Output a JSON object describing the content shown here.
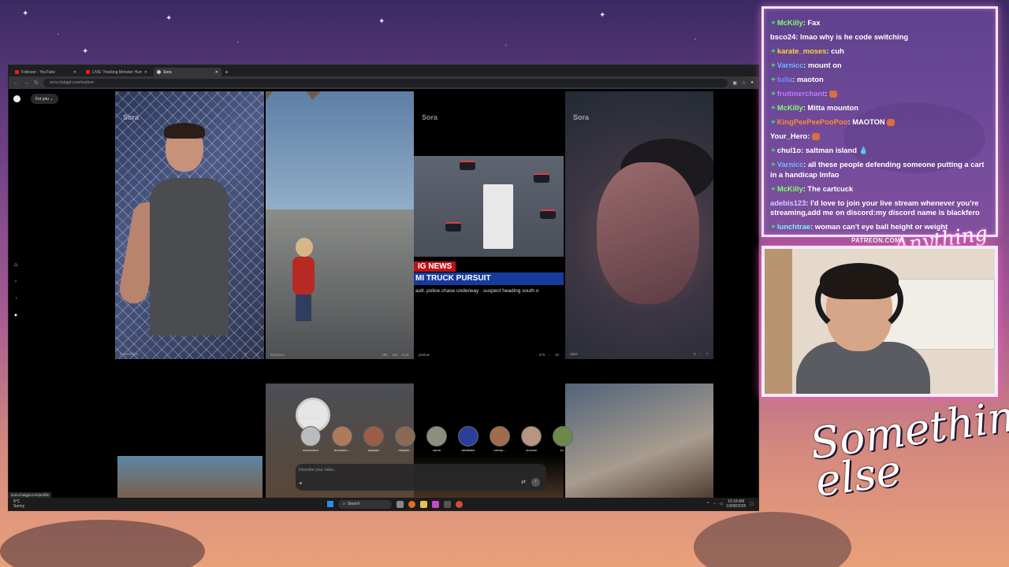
{
  "browser": {
    "tabs": [
      {
        "label": "Follower - YouTube",
        "icon": "youtube-icon"
      },
      {
        "label": "LIVE: Tracking Monster Hurricane",
        "icon": "youtube-icon"
      },
      {
        "label": "Sora",
        "icon": "sora-icon"
      }
    ],
    "url": "sora.chatgpt.com/explore",
    "new_tab": "+"
  },
  "sora": {
    "feed_label": "For you",
    "watermark": "Sora",
    "tiles": [
      {
        "user": "sorasrifeike",
        "likes": "3",
        "comments": "",
        "remixes": ""
      },
      {
        "user": "fancyson",
        "likes": "15K",
        "comments": "181",
        "remixes": "3.1K"
      },
      {
        "user": "jamlow",
        "likes": "270",
        "comments": "",
        "remixes": "10"
      },
      {
        "user": "ridon",
        "likes": "2",
        "comments": "",
        "remixes": ""
      }
    ],
    "news": {
      "tag": "IG NEWS",
      "headline": "MI TRUCK PURSUIT",
      "ticker": "ault. police chase underway · suspect heading south o"
    },
    "add_cameo_label": "Add cameo",
    "cameos": [
      {
        "name": "memoution",
        "color": "#bbbbbb"
      },
      {
        "name": "duncanfo...",
        "color": "#b07a5a"
      },
      {
        "name": "jakepaul",
        "color": "#9c5d44"
      },
      {
        "name": "rickyber...",
        "color": "#8a6a55"
      },
      {
        "name": "sama",
        "color": "#8e8e80"
      },
      {
        "name": "steakfake",
        "color": "#2b3e9a"
      },
      {
        "name": "carlmp...",
        "color": "#a06d4c"
      },
      {
        "name": "mcuban",
        "color": "#b99480"
      },
      {
        "name": "Ja...",
        "color": "#6b8a4a"
      }
    ],
    "composer": {
      "placeholder": "Describe your video...",
      "plus": "+",
      "settings_glyph": "⇄",
      "send_glyph": "↑"
    }
  },
  "status_url": "sora.chatgpt.com/profile",
  "taskbar": {
    "weather_temp": "8°C",
    "weather_desc": "Sunny",
    "search_label": "Search",
    "time": "10:18 AM",
    "date": "10/08/2025"
  },
  "chat": {
    "messages": [
      {
        "user": "McKilly",
        "color": "#7cff6a",
        "badge": true,
        "text": "Fax"
      },
      {
        "user": "bsco24",
        "color": "#ffffff",
        "badge": false,
        "text": "lmao why is he code switching"
      },
      {
        "user": "karate_moses",
        "color": "#ffd23f",
        "badge": true,
        "text": "cuh"
      },
      {
        "user": "Varnicc",
        "color": "#6fb6ff",
        "badge": true,
        "text": "mount on"
      },
      {
        "user": "tulla",
        "color": "#6f8cff",
        "badge": true,
        "text": "maoton"
      },
      {
        "user": "fruitmerchant",
        "color": "#b97cff",
        "badge": true,
        "text": "",
        "emote": true
      },
      {
        "user": "McKilly",
        "color": "#7cff6a",
        "badge": true,
        "text": "Mitta mounton"
      },
      {
        "user": "KingPeePeePooPoo",
        "color": "#ff8a2a",
        "badge": true,
        "text": "MAOTON",
        "emote": true
      },
      {
        "user": "Your_Hero",
        "color": "#ffffff",
        "badge": false,
        "text": "",
        "emote": true
      },
      {
        "user": "chul1o",
        "color": "#ffffff",
        "badge": true,
        "text": "saltman island 💧"
      },
      {
        "user": "Varnicc",
        "color": "#6fb6ff",
        "badge": true,
        "text": "all these people defending someone putting a cart in a handicap lmfao"
      },
      {
        "user": "McKilly",
        "color": "#7cff6a",
        "badge": true,
        "text": "The cartcuck"
      },
      {
        "user": "adebis123",
        "color": "#cfcfff",
        "badge": false,
        "text": "I'd love to join your live stream whenever you're streaming,add me on discord:my discord name is blackfero"
      },
      {
        "user": "lunchtrae",
        "color": "#7df0ff",
        "badge": true,
        "text": "woman can't eye ball height or weight"
      }
    ]
  },
  "overlay": {
    "patreon": "PATREON.COM/",
    "brand_small": "Anything else",
    "brand_big": "Something else"
  }
}
